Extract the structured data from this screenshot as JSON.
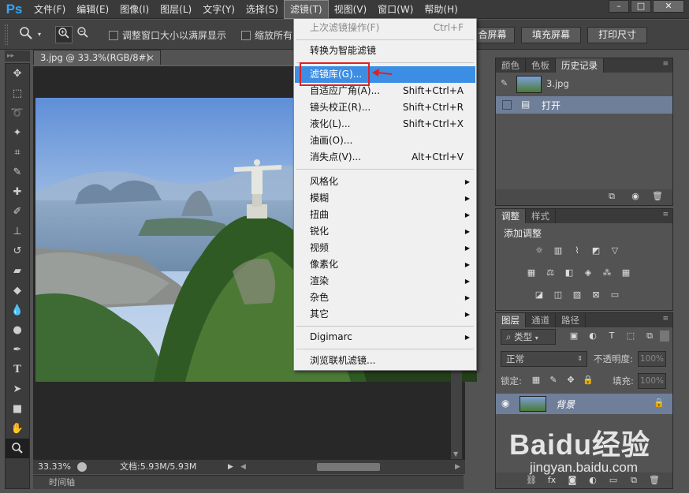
{
  "app": {
    "logo": "Ps"
  },
  "menubar": {
    "items": [
      "文件(F)",
      "编辑(E)",
      "图像(I)",
      "图层(L)",
      "文字(Y)",
      "选择(S)",
      "滤镜(T)",
      "视图(V)",
      "窗口(W)",
      "帮助(H)"
    ],
    "active": "滤镜(T)",
    "window_buttons": [
      "–",
      "□",
      "✕"
    ]
  },
  "options_bar": {
    "checkbox1_label": "调整窗口大小以满屏显示",
    "checkbox2_label": "缩放所有",
    "fit_screen_label": "合屏幕",
    "fill_screen_label": "填充屏幕",
    "print_size_label": "打印尺寸"
  },
  "document": {
    "tab_title": "3.jpg @ 33.3%(RGB/8#)",
    "tab_close": "×",
    "zoom": "33.33%",
    "doc_info": "文档:5.93M/5.93M",
    "timeline_label": "时间轴"
  },
  "filter_menu": {
    "items": [
      {
        "label": "上次滤镜操作(F)",
        "shortcut": "Ctrl+F",
        "disabled": true
      },
      {
        "label": "转换为智能滤镜",
        "shortcut": ""
      },
      {
        "label": "滤镜库(G)...",
        "shortcut": "",
        "highlight": true
      },
      {
        "label": "自适应广角(A)...",
        "shortcut": "Shift+Ctrl+A"
      },
      {
        "label": "镜头校正(R)...",
        "shortcut": "Shift+Ctrl+R"
      },
      {
        "label": "液化(L)...",
        "shortcut": "Shift+Ctrl+X"
      },
      {
        "label": "油画(O)...",
        "shortcut": ""
      },
      {
        "label": "消失点(V)...",
        "shortcut": "Alt+Ctrl+V"
      },
      {
        "label": "风格化",
        "submenu": true
      },
      {
        "label": "模糊",
        "submenu": true
      },
      {
        "label": "扭曲",
        "submenu": true
      },
      {
        "label": "锐化",
        "submenu": true
      },
      {
        "label": "视频",
        "submenu": true
      },
      {
        "label": "像素化",
        "submenu": true
      },
      {
        "label": "渲染",
        "submenu": true
      },
      {
        "label": "杂色",
        "submenu": true
      },
      {
        "label": "其它",
        "submenu": true
      },
      {
        "label": "Digimarc",
        "submenu": true
      },
      {
        "label": "浏览联机滤镜..."
      }
    ]
  },
  "history_panel": {
    "tabs": [
      "颜色",
      "色板",
      "历史记录"
    ],
    "active_tab": "历史记录",
    "snapshot_name": "3.jpg",
    "step_label": "打开"
  },
  "adjustments_panel": {
    "tabs": [
      "调整",
      "样式"
    ],
    "active_tab": "调整",
    "title": "添加调整"
  },
  "layers_panel": {
    "tabs": [
      "图层",
      "通道",
      "路径"
    ],
    "active_tab": "图层",
    "filter_kind": "类型",
    "blend_mode": "正常",
    "opacity_label": "不透明度:",
    "opacity_value": "100%",
    "lock_label": "锁定:",
    "fill_label": "填充:",
    "fill_value": "100%",
    "layer_name": "背景"
  },
  "watermark": {
    "brand": "Baidu经验",
    "url": "jingyan.baidu.com"
  }
}
